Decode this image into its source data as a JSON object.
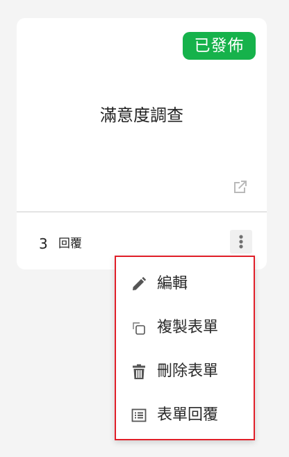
{
  "card": {
    "status_badge": "已發佈",
    "title": "滿意度調查",
    "response_count": "3",
    "response_label": "回覆"
  },
  "menu": {
    "items": [
      {
        "label": "編輯",
        "icon": "pencil-icon"
      },
      {
        "label": "複製表單",
        "icon": "copy-icon"
      },
      {
        "label": "刪除表單",
        "icon": "trash-icon"
      },
      {
        "label": "表單回覆",
        "icon": "list-icon"
      }
    ]
  },
  "colors": {
    "badge_green": "#16b24b",
    "menu_highlight_border": "#e01e28",
    "icon_gray": "#555555"
  }
}
